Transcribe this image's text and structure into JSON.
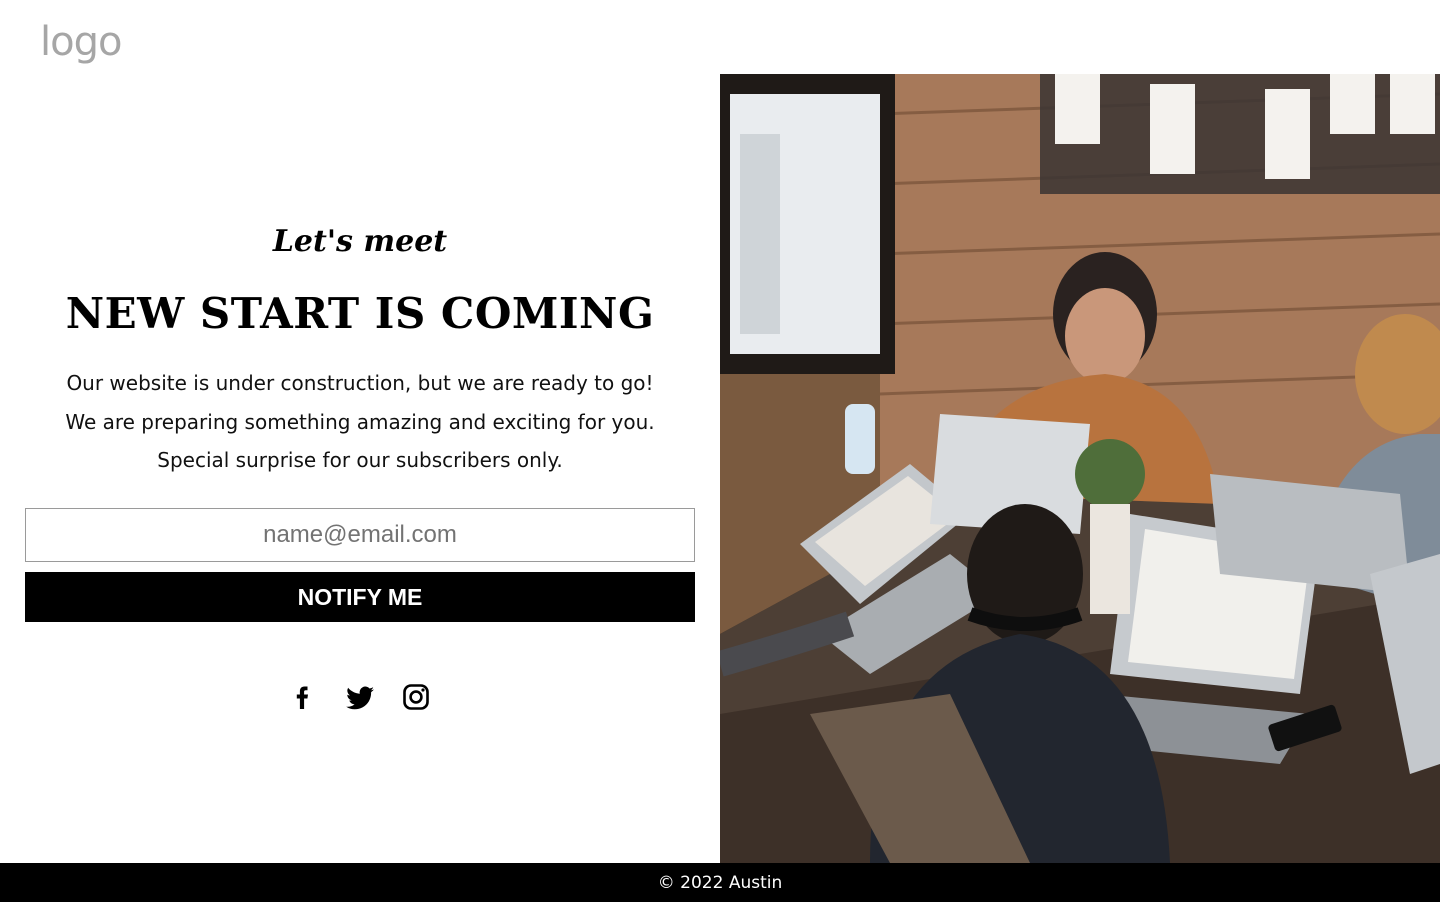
{
  "logo": {
    "text": "logo"
  },
  "hero": {
    "eyebrow": "Let's meet",
    "headline": "NEW START IS COMING",
    "description": [
      "Our website is under construction, but we are ready to go!",
      "We are preparing something amazing and exciting for you.",
      "Special surprise for our subscribers only."
    ]
  },
  "signup": {
    "email_placeholder": "name@email.com",
    "notify_label": "NOTIFY ME"
  },
  "social": {
    "icons": [
      "facebook-icon",
      "twitter-icon",
      "instagram-icon"
    ]
  },
  "footer": {
    "copyright": "© 2022 Austin"
  },
  "colors": {
    "text": "#000000",
    "button_bg": "#000000",
    "button_text": "#ffffff",
    "logo": "#a6a6a6",
    "footer_bg": "#000000"
  }
}
